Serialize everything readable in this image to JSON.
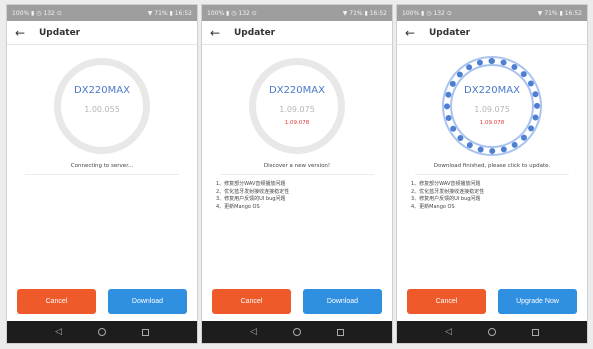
{
  "statusbar": {
    "left": "100% ▮ ◷ 132 ⊙",
    "right": "▼ 71% ▮ 16:52"
  },
  "screens": [
    {
      "title": "Updater",
      "model": "DX220MAX",
      "current_version": "1.00.055",
      "new_version": "",
      "status": "Connecting to server...",
      "notes": [],
      "cancel": "Cancel",
      "primary": "Download"
    },
    {
      "title": "Updater",
      "model": "DX220MAX",
      "current_version": "1.09.075",
      "new_version": "1.09.078",
      "status": "Discover a new version!",
      "notes": [
        "1、修复部分WAV音频播放问题",
        "2、优化蓝牙发射接收连接稳定性",
        "3、修复用户反馈的UI bug问题",
        "4、更新Mango OS"
      ],
      "cancel": "Cancel",
      "primary": "Download"
    },
    {
      "title": "Updater",
      "model": "DX220MAX",
      "current_version": "1.09.075",
      "new_version": "1.09.078",
      "status": "Download finished, please click to update.",
      "notes": [
        "1、修复部分WAV音频播放问题",
        "2、优化蓝牙发射接收连接稳定性",
        "3、修复用户反馈的UI bug问题",
        "4、更新Mango OS"
      ],
      "cancel": "Cancel",
      "primary": "Upgrade Now"
    }
  ],
  "icons": {
    "back": "back-arrow-icon",
    "nav": [
      "nav-back-icon",
      "nav-home-icon",
      "nav-recents-icon"
    ]
  },
  "colors": {
    "accent": "#4a78c8",
    "cancel": "#ef5a2a",
    "primary": "#2f8fe0",
    "new_version": "#e53935"
  }
}
